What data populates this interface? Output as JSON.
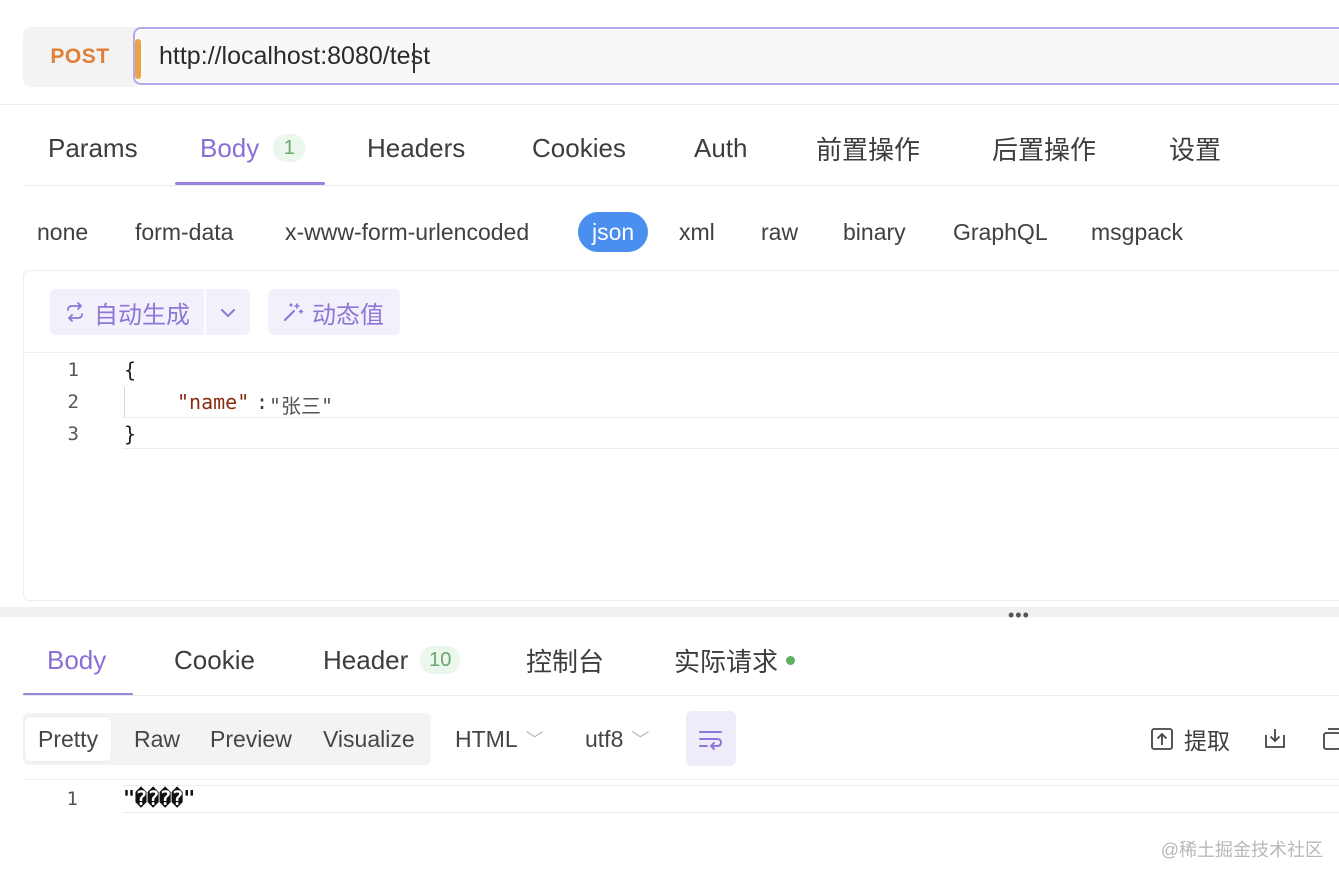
{
  "request": {
    "method": "POST",
    "url": "http://localhost:8080/test"
  },
  "request_tabs": [
    {
      "label": "Params"
    },
    {
      "label": "Body",
      "badge": "1",
      "active": true
    },
    {
      "label": "Headers"
    },
    {
      "label": "Cookies"
    },
    {
      "label": "Auth"
    },
    {
      "label": "前置操作"
    },
    {
      "label": "后置操作"
    },
    {
      "label": "设置"
    }
  ],
  "body_types": [
    "none",
    "form-data",
    "x-www-form-urlencoded",
    "json",
    "xml",
    "raw",
    "binary",
    "GraphQL",
    "msgpack"
  ],
  "body_type_selected": "json",
  "editor_toolbar": {
    "auto_generate": "自动生成",
    "dynamic_value": "动态值"
  },
  "request_body_lines": {
    "n1": "1",
    "n2": "2",
    "n3": "3",
    "open": "{",
    "key": "\"name\"",
    "colon": ":",
    "value": "\"张三\"",
    "close": "}"
  },
  "response_tabs": [
    {
      "label": "Body",
      "active": true
    },
    {
      "label": "Cookie"
    },
    {
      "label": "Header",
      "badge": "10"
    },
    {
      "label": "控制台"
    },
    {
      "label": "实际请求",
      "dot": true
    }
  ],
  "response_view": {
    "modes": [
      "Pretty",
      "Raw",
      "Preview",
      "Visualize"
    ],
    "active_mode": "Pretty",
    "format": "HTML",
    "encoding": "utf8",
    "extract": "提取"
  },
  "response_body_lines": {
    "n1": "1",
    "text": "\"����\""
  },
  "watermark": "@稀土掘金技术社区",
  "colors": {
    "accent": "#8b6fd6",
    "method": "#e07f35",
    "selected_type": "#4a8ef0",
    "badge_green": "#6aa86e"
  }
}
